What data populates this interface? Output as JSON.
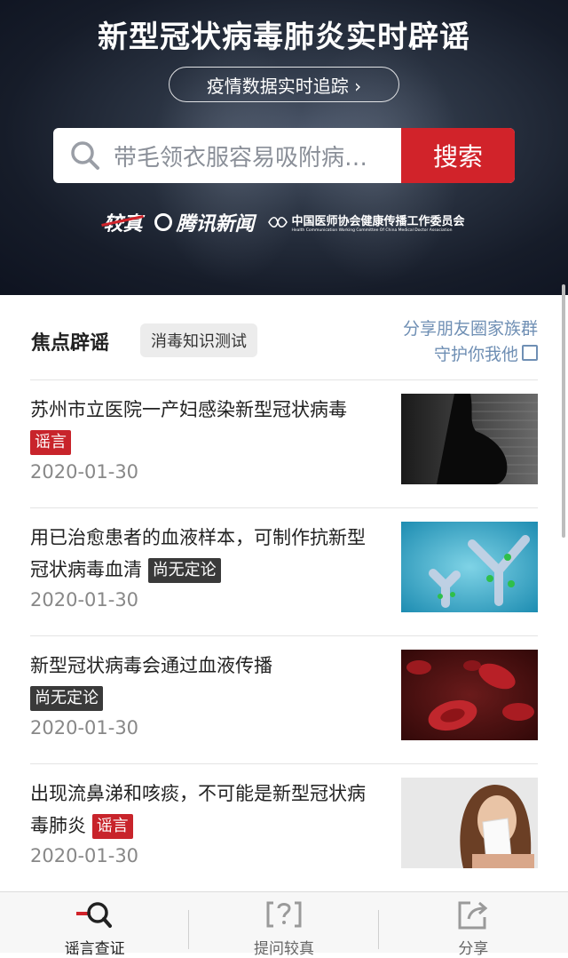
{
  "header": {
    "title": "新型冠状病毒肺炎实时辟谣",
    "tracker_label": "疫情数据实时追踪 ›",
    "search": {
      "placeholder": "带毛领衣服容易吸附病…",
      "button_label": "搜索"
    },
    "partners": {
      "jiaozhen": "较真",
      "tencent": "腾讯新闻",
      "association": "中国医师协会健康传播工作委员会",
      "association_en": "Health Communication Working Committee Of China Medical Doctor Association"
    }
  },
  "focus": {
    "title": "焦点辟谣",
    "quiz_label": "消毒知识测试",
    "share_line1": "分享朋友圈家族群",
    "share_line2": "守护你我他"
  },
  "items": [
    {
      "title": "苏州市立医院一产妇感染新型冠状病毒",
      "tag": "谣言",
      "tag_style": "red",
      "date": "2020-01-30",
      "thumb": "pregnant-silhouette"
    },
    {
      "title": "用已治愈患者的血液样本，可制作抗新型冠状病毒血清",
      "tag": "尚无定论",
      "tag_style": "dark",
      "date": "2020-01-30",
      "thumb": "antibody"
    },
    {
      "title": "新型冠状病毒会通过血液传播",
      "tag": "尚无定论",
      "tag_style": "dark",
      "date": "2020-01-30",
      "thumb": "blood-cells"
    },
    {
      "title": "出现流鼻涕和咳痰，不可能是新型冠状病毒肺炎",
      "tag": "谣言",
      "tag_style": "red",
      "date": "2020-01-30",
      "thumb": "sneezing-woman"
    }
  ],
  "tabbar": [
    {
      "label": "谣言查证",
      "icon": "rumor-check-icon",
      "active": true
    },
    {
      "label": "提问较真",
      "icon": "question-icon",
      "active": false
    },
    {
      "label": "分享",
      "icon": "share-icon",
      "active": false
    }
  ],
  "colors": {
    "accent": "#d1232a",
    "link": "#6f8fb4",
    "dark_tag": "#3a3a3a"
  }
}
